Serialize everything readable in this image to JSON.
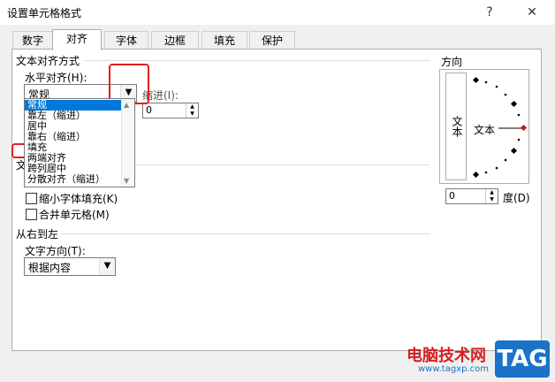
{
  "window": {
    "title": "设置单元格格式",
    "help": "?",
    "close": "✕"
  },
  "tabs": [
    "数字",
    "对齐",
    "字体",
    "边框",
    "填充",
    "保护"
  ],
  "text_alignment": {
    "section_title": "文本对齐方式",
    "horizontal_label": "水平对齐(H):",
    "horizontal_value": "常规",
    "indent_label": "缩进(I):",
    "indent_value": "0",
    "dropdown_options": [
      "常规",
      "靠左（缩进）",
      "居中",
      "靠右（缩进）",
      "填充",
      "两端对齐",
      "跨列居中",
      "分散对齐（缩进）"
    ],
    "selected_option": "常规"
  },
  "text_control": {
    "section_title_partial": "文",
    "shrink_label": "缩小字体填充(K)",
    "merge_label": "合并单元格(M)"
  },
  "rtl": {
    "section_title": "从右到左",
    "direction_label": "文字方向(T):",
    "direction_value": "根据内容"
  },
  "orientation": {
    "section_title": "方向",
    "vertical_text": "文本",
    "horizontal_text": "文本",
    "degree_value": "0",
    "degree_label": "度(D)"
  },
  "watermark": {
    "site": "电脑技术网",
    "url": "www.tagxp.com",
    "tag": "TAG"
  },
  "colors": {
    "highlight": "#e02020",
    "selection": "#0078d7",
    "tag_bg": "#1a73c8"
  }
}
